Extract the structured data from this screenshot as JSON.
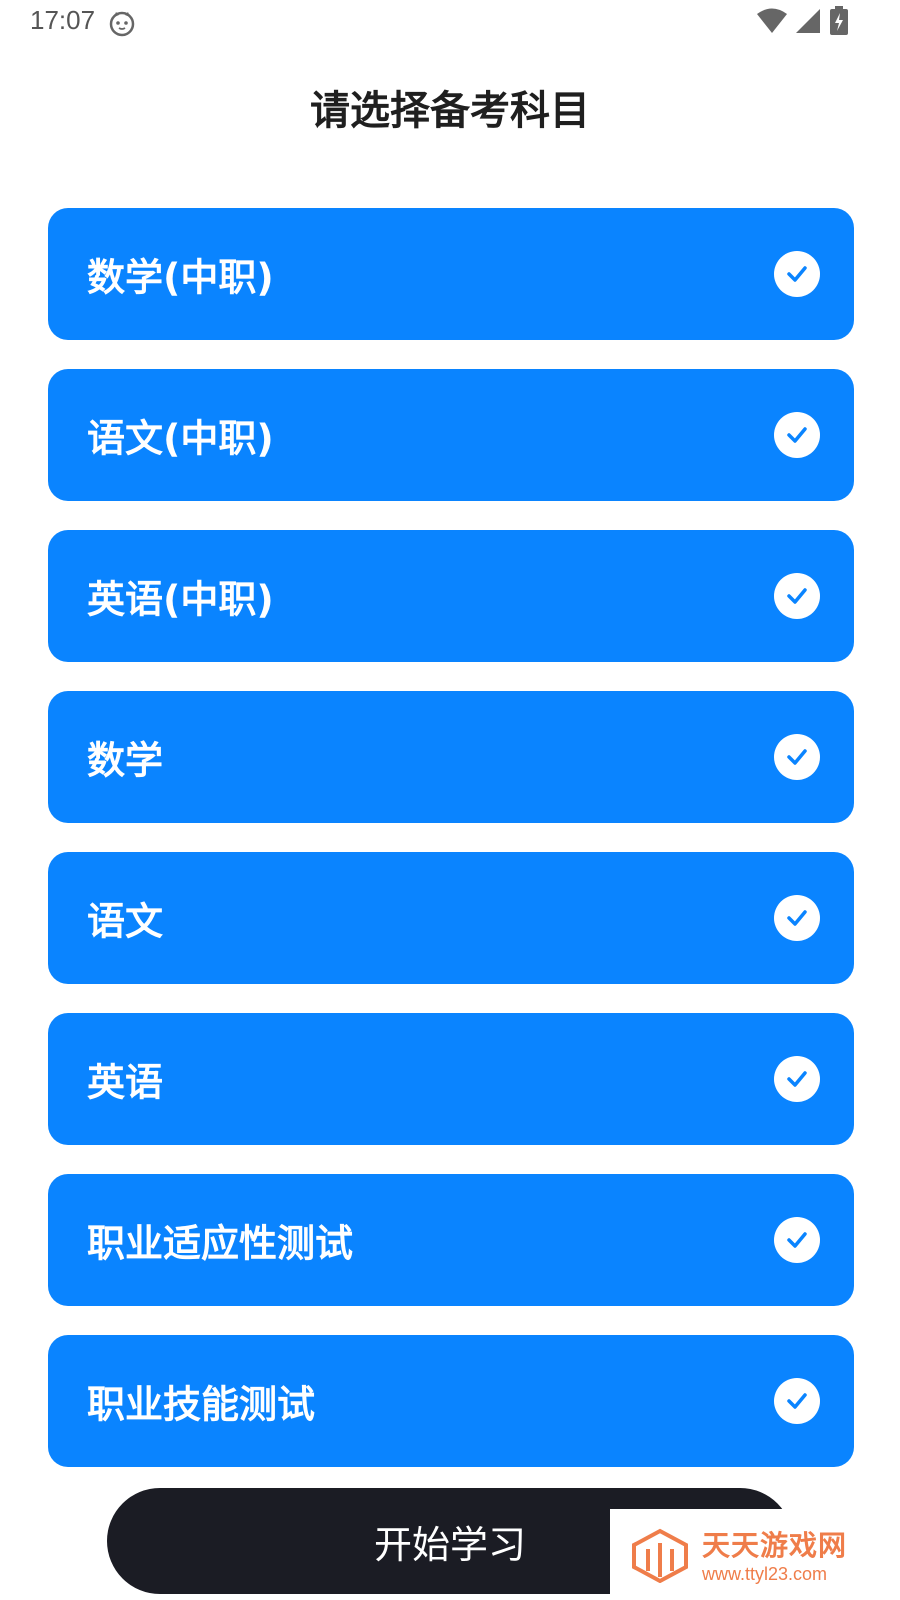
{
  "status_bar": {
    "time": "17:07",
    "icons": [
      "cat-icon",
      "wifi-icon",
      "signal-icon",
      "battery-charging-icon"
    ]
  },
  "page": {
    "title": "请选择备考科目"
  },
  "subjects": [
    {
      "label": "数学(中职)",
      "selected": true
    },
    {
      "label": "语文(中职)",
      "selected": true
    },
    {
      "label": "英语(中职)",
      "selected": true
    },
    {
      "label": "数学",
      "selected": true
    },
    {
      "label": "语文",
      "selected": true
    },
    {
      "label": "英语",
      "selected": true
    },
    {
      "label": "职业适应性测试",
      "selected": true
    },
    {
      "label": "职业技能测试",
      "selected": true
    }
  ],
  "start_button": {
    "label": "开始学习"
  },
  "watermark": {
    "title": "天天游戏网",
    "url": "www.ttyl23.com"
  },
  "colors": {
    "card_bg": "#0a84ff",
    "button_bg": "#1b1c24",
    "title_text": "#1f1f1f",
    "watermark": "#ef7d4a"
  }
}
